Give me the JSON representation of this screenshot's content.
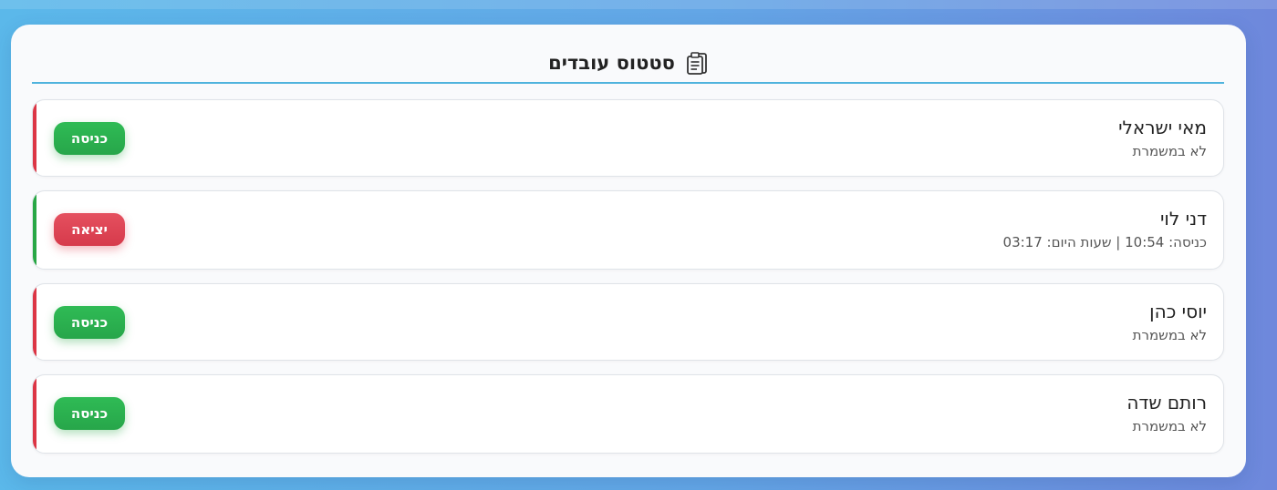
{
  "header": {
    "title": "סטטוס עובדים",
    "icon": "clipboard-icon"
  },
  "colors": {
    "accent_off_shift": "#dc3545",
    "accent_on_shift": "#28a745",
    "button_enter": "#28a745",
    "button_exit": "#dc3545",
    "header_underline": "#4fb3dd"
  },
  "employees": [
    {
      "name": "מאי ישראלי",
      "status": "לא במשמרת",
      "action": "כניסה",
      "on_shift": false
    },
    {
      "name": "דני לוי",
      "status": "כניסה: 10:54 | שעות היום: 03:17",
      "action": "יציאה",
      "on_shift": true
    },
    {
      "name": "יוסי כהן",
      "status": "לא במשמרת",
      "action": "כניסה",
      "on_shift": false
    },
    {
      "name": "רותם שדה",
      "status": "לא במשמרת",
      "action": "כניסה",
      "on_shift": false
    }
  ]
}
